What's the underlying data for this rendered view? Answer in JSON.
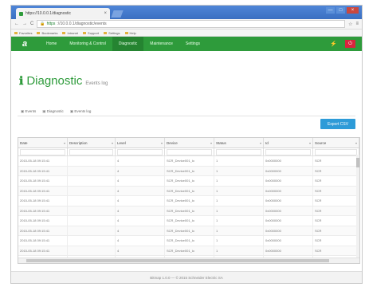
{
  "browser": {
    "tab_title": "https://10.0.0.1/diagnostic",
    "close_glyph": "×",
    "address_proto": "https",
    "address_host": "://10.0.0.1/diagnostic/events",
    "nav_back": "←",
    "nav_forward": "→",
    "nav_reload": "C",
    "bookmarks": [
      "Favorites",
      "Bookmarks",
      "Intranet",
      "Support",
      "Settings",
      "Help"
    ],
    "window_buttons": [
      "—",
      "□",
      "×"
    ]
  },
  "app_nav": {
    "logo": "a",
    "items": [
      "Home",
      "Monitoring & Control",
      "Diagnostic",
      "Maintenance",
      "Settings"
    ],
    "active_index": 2,
    "right_icon": "⚡",
    "right_badge": "⏻"
  },
  "page": {
    "icon": "ℹ",
    "title": "Diagnostic",
    "subtitle": "Events log",
    "subtabs": [
      "Events",
      "Diagnostic",
      "Events log"
    ],
    "export_button": "Export CSV"
  },
  "table": {
    "columns": [
      "Date",
      "Description",
      "Level",
      "Device",
      "Status",
      "Id",
      "Source"
    ],
    "rows": [
      [
        "2015-05-18 09:15:41",
        "",
        "4",
        "SCR_Device001_lo",
        "1",
        "0x0000000",
        "SCR"
      ],
      [
        "2015-05-18 09:15:41",
        "",
        "4",
        "SCR_Device001_lo",
        "1",
        "0x0000000",
        "SCR"
      ],
      [
        "2015-05-18 09:15:41",
        "",
        "4",
        "SCR_Device001_lo",
        "1",
        "0x0000000",
        "SCR"
      ],
      [
        "2015-05-18 09:15:41",
        "",
        "4",
        "SCR_Device001_lo",
        "1",
        "0x0000000",
        "SCR"
      ],
      [
        "2015-05-18 09:15:41",
        "",
        "4",
        "SCR_Device001_lo",
        "1",
        "0x0000000",
        "SCR"
      ],
      [
        "2015-05-18 09:15:41",
        "",
        "4",
        "SCR_Device001_lo",
        "1",
        "0x0000000",
        "SCR"
      ],
      [
        "2015-05-18 09:15:41",
        "",
        "4",
        "SCR_Device001_lo",
        "1",
        "0x0000000",
        "SCR"
      ],
      [
        "2015-05-18 09:15:41",
        "",
        "4",
        "SCR_Device001_lo",
        "1",
        "0x0000000",
        "SCR"
      ],
      [
        "2015-05-18 09:15:41",
        "",
        "4",
        "SCR_Device001_lo",
        "1",
        "0x0000000",
        "SCR"
      ],
      [
        "2015-05-18 09:15:41",
        "",
        "4",
        "SCR_Device001_lo",
        "1",
        "0x0000000",
        "SCR"
      ],
      [
        "2015-05-18 09:15:41",
        "",
        "4",
        "SCR_Device001_lo",
        "1",
        "0x0000000",
        "SCR"
      ]
    ]
  },
  "footer": {
    "text": "Bitmap 1.0.0 — © 2015 Schneider Electric SA"
  },
  "colors": {
    "brand_green": "#2e9b3b",
    "export_blue": "#2d9bd8",
    "danger_red": "#d9243d",
    "browser_blue": "#3a6fc1"
  }
}
